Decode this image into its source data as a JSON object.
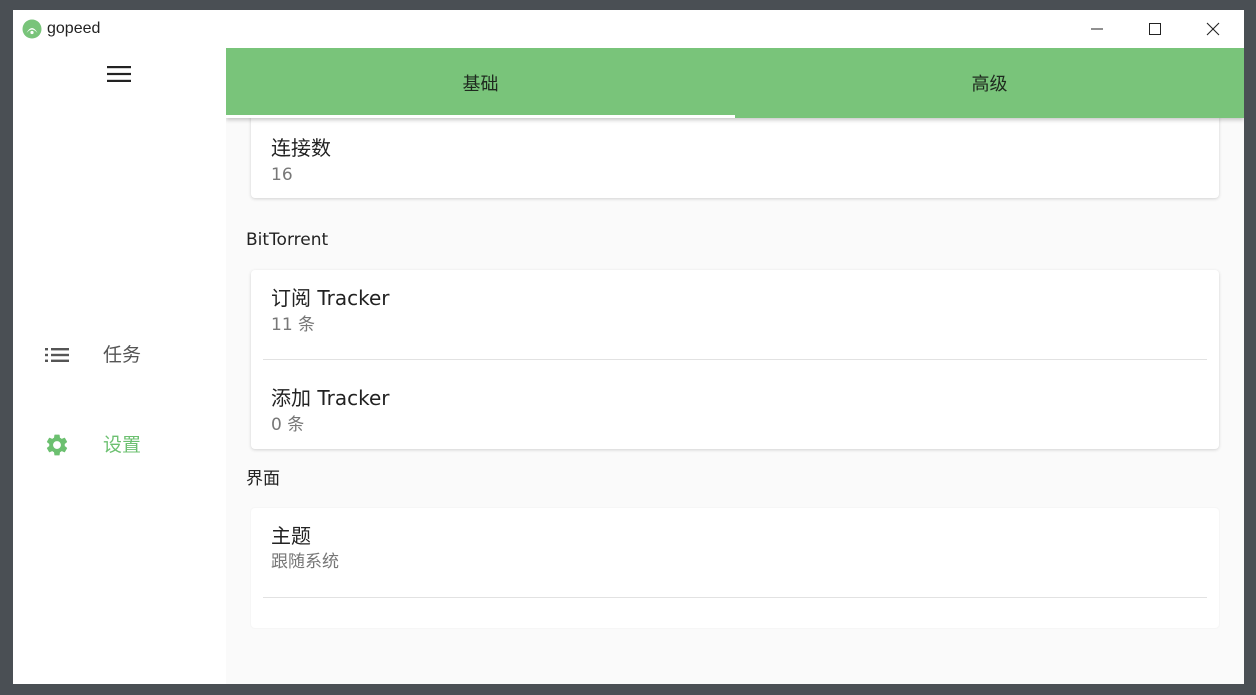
{
  "window": {
    "title": "gopeed",
    "controls": {
      "minimize_icon": "minimize-icon",
      "maximize_icon": "maximize-icon",
      "close_icon": "close-icon"
    }
  },
  "colors": {
    "accent": "#79c47a",
    "active_nav": "#6cc070",
    "background": "#fafafa"
  },
  "sidebar": {
    "menu_icon": "hamburger-menu-icon",
    "items": [
      {
        "label": "任务",
        "icon": "list-icon",
        "active": false
      },
      {
        "label": "设置",
        "icon": "gear-icon",
        "active": true
      }
    ]
  },
  "tabs": [
    {
      "label": "基础",
      "active": true
    },
    {
      "label": "高级",
      "active": false
    }
  ],
  "settings": {
    "connections": {
      "title": "连接数",
      "value": "16"
    },
    "bittorrent": {
      "section": "BitTorrent",
      "subscribe_tracker": {
        "title": "订阅 Tracker",
        "value": "11 条"
      },
      "add_tracker": {
        "title": "添加 Tracker",
        "value": "0 条"
      }
    },
    "interface": {
      "section": "界面",
      "theme": {
        "title": "主题",
        "value": "跟随系统"
      }
    }
  }
}
